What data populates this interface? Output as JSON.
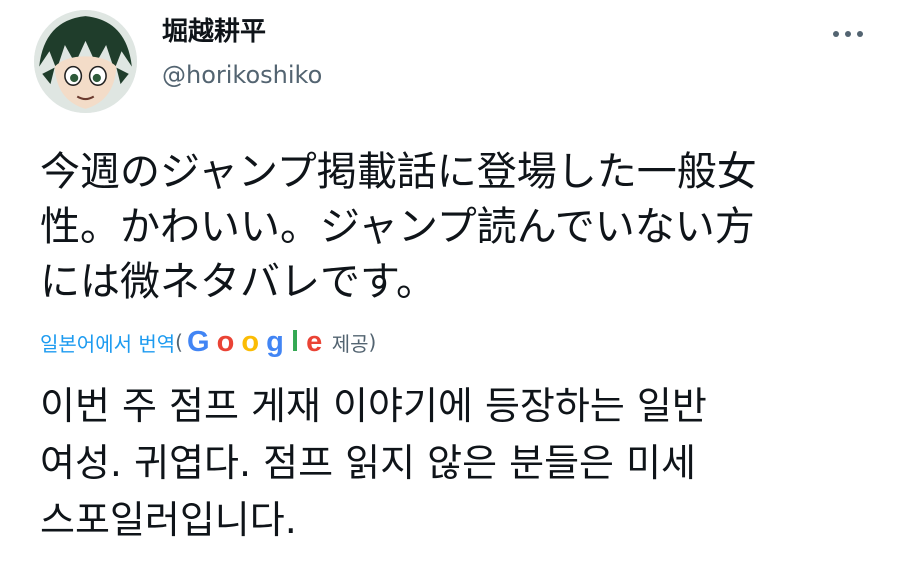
{
  "tweet": {
    "author": {
      "display_name": "堀越耕平",
      "handle": "@horikoshiko",
      "avatar": "avatar-image"
    },
    "more_icon": "more-dots-icon",
    "text": "今週のジャンプ掲載話に登場した一般女\n性。かわいい。ジャンプ読んでいない方\nには微ネタバレです。",
    "translation": {
      "link_label": "일본어에서 번역",
      "paren_open": "(",
      "provider_label": "제공",
      "paren_close": ")",
      "google_letters": [
        {
          "ch": "G",
          "color": "#4285f4"
        },
        {
          "ch": "o",
          "color": "#ea4335"
        },
        {
          "ch": "o",
          "color": "#fbbc05"
        },
        {
          "ch": "g",
          "color": "#4285f4"
        },
        {
          "ch": "l",
          "color": "#34a853"
        },
        {
          "ch": "e",
          "color": "#ea4335"
        }
      ],
      "text": "이번 주 점프 게재 이야기에 등장하는 일반\n여성. 귀엽다. 점프 읽지 않은 분들은 미세\n스포일러입니다."
    }
  },
  "colors": {
    "link": "#1d9bf0",
    "secondary_text": "#536471",
    "primary_text": "#0f1419"
  }
}
